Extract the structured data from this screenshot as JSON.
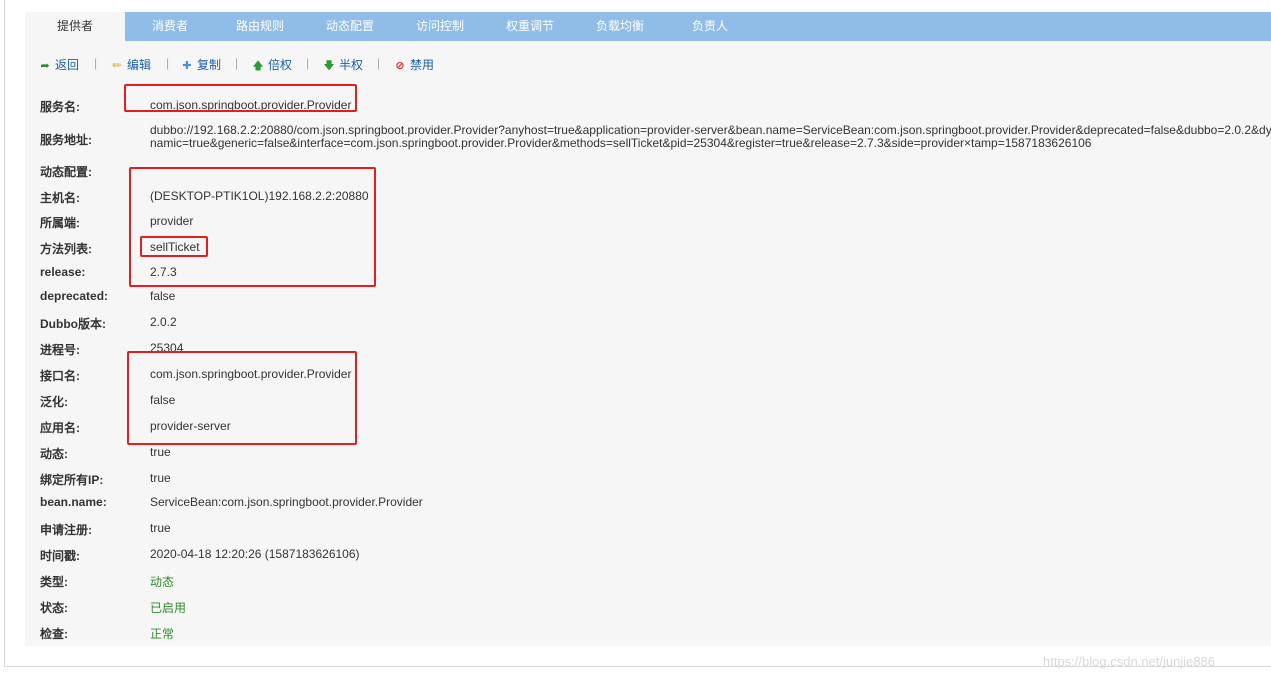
{
  "tabs": [
    "提供者",
    "消费者",
    "路由规则",
    "动态配置",
    "访问控制",
    "权重调节",
    "负载均衡",
    "负责人"
  ],
  "toolbar": {
    "back": "返回",
    "edit": "编辑",
    "copy": "复制",
    "double_weight": "倍权",
    "half_weight": "半权",
    "disable": "禁用",
    "separator": "|"
  },
  "fields": [
    {
      "label": "服务名:",
      "value": "com.json.springboot.provider.Provider"
    },
    {
      "label": "服务地址:",
      "value": "dubbo://192.168.2.2:20880/com.json.springboot.provider.Provider?anyhost=true&application=provider-server&bean.name=ServiceBean:com.json.springboot.provider.Provider&deprecated=false&dubbo=2.0.2&dynamic=true&generic=false&interface=com.json.springboot.provider.Provider&methods=sellTicket&pid=25304&register=true&release=2.7.3&side=provider×tamp=1587183626106"
    },
    {
      "label": "动态配置:",
      "value": ""
    },
    {
      "label": "主机名:",
      "value": "(DESKTOP-PTIK1OL)192.168.2.2:20880"
    },
    {
      "label": "所属端:",
      "value": "provider"
    },
    {
      "label": "方法列表:",
      "value": "sellTicket"
    },
    {
      "label": "release:",
      "value": "2.7.3"
    },
    {
      "label": "deprecated:",
      "value": "false"
    },
    {
      "label": "Dubbo版本:",
      "value": "2.0.2"
    },
    {
      "label": "进程号:",
      "value": "25304"
    },
    {
      "label": "接口名:",
      "value": "com.json.springboot.provider.Provider"
    },
    {
      "label": "泛化:",
      "value": "false"
    },
    {
      "label": "应用名:",
      "value": "provider-server"
    },
    {
      "label": "动态:",
      "value": "true"
    },
    {
      "label": "绑定所有IP:",
      "value": "true"
    },
    {
      "label": "bean.name:",
      "value": "ServiceBean:com.json.springboot.provider.Provider"
    },
    {
      "label": "申请注册:",
      "value": "true"
    },
    {
      "label": "时间戳:",
      "value": "2020-04-18 12:20:26 (1587183626106)"
    },
    {
      "label": "类型:",
      "value": "动态"
    },
    {
      "label": "状态:",
      "value": "已启用"
    },
    {
      "label": "检查:",
      "value": "正常"
    }
  ],
  "watermark": "https://blog.csdn.net/junjie886",
  "colors": {
    "tab_bar": "#8fbde8",
    "link": "#1a5fa8",
    "highlight": "#e02020",
    "status_green": "#2e8b2e"
  },
  "icons": [
    "back-arrow-icon",
    "pencil-icon",
    "plus-icon",
    "arrow-up-icon",
    "arrow-down-icon",
    "forbidden-icon"
  ]
}
